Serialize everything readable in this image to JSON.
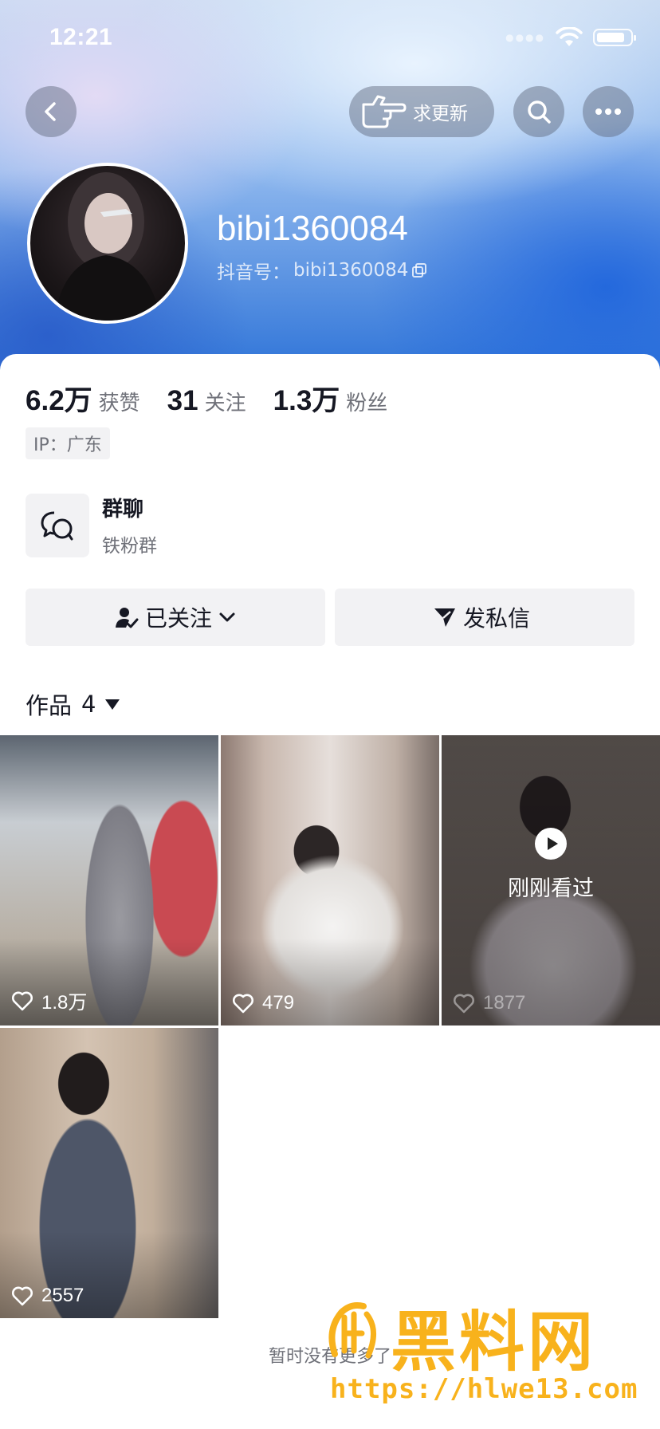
{
  "status_bar": {
    "time": "12:21"
  },
  "header": {
    "update_label": "求更新",
    "username": "bibi1360084",
    "douyin_id_label": "抖音号：",
    "douyin_id": "bibi1360084"
  },
  "stats": [
    {
      "num": "6.2万",
      "label": "获赞"
    },
    {
      "num": "31",
      "label": "关注"
    },
    {
      "num": "1.3万",
      "label": "粉丝"
    }
  ],
  "ip_label": "IP：广东",
  "group": {
    "title": "群聊",
    "subtitle": "铁粉群"
  },
  "actions": {
    "follow_label": "已关注",
    "message_label": "发私信"
  },
  "works": {
    "label": "作品",
    "count": "4"
  },
  "videos": [
    {
      "likes": "1.8万"
    },
    {
      "likes": "479"
    },
    {
      "likes": "1877",
      "recent_label": "刚刚看过"
    },
    {
      "likes": "2557"
    }
  ],
  "footer_text": "暂时没有更多了",
  "watermark": {
    "title": "黑料网",
    "url": "https://hlwe13.com"
  },
  "colors": {
    "accent": "#f8b21c",
    "text_primary": "#161823",
    "text_secondary": "#6f7179",
    "button_bg": "#f2f2f4"
  }
}
